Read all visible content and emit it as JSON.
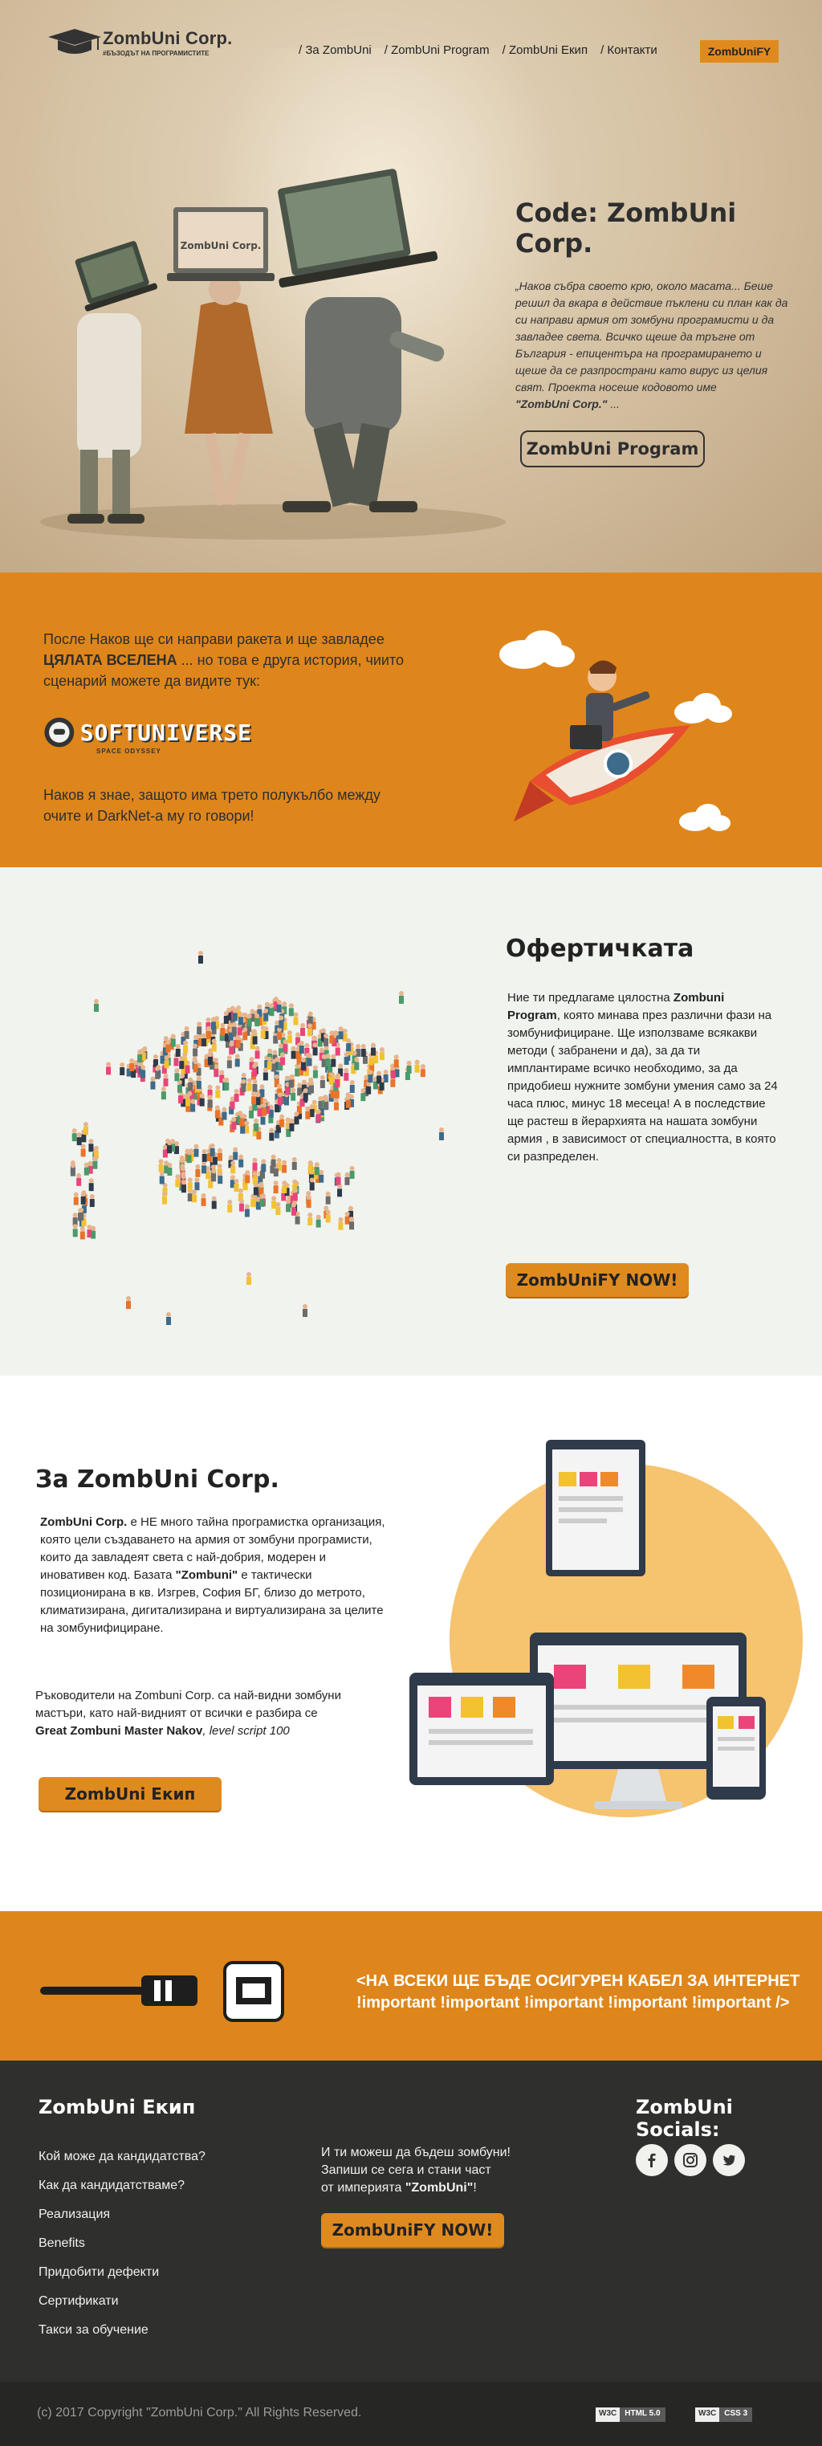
{
  "brand": {
    "name": "ZombUni Corp.",
    "tagline": "#БЪЗОДЪТ НА ПРОГРАМИСТИТЕ"
  },
  "nav": {
    "items": [
      "/ За ZombUni",
      "/ ZombUni Program",
      "/ ZombUni Екип",
      "/ Контакти"
    ],
    "cta": "ZombUniFY"
  },
  "hero": {
    "title": "Code: ZombUni Corp.",
    "text_main": "„Наков събра своето крю, около масата... Беше решил да вкара в действие пъклени си план как да си направи армия от зомбуни програмисти и да завладее света. Всичко щеше да тръгне от България - епицентъра на програмирането и щеше да се разпространи като вирус из целия свят. Проекта носеше кодовото име",
    "text_bold": "\"ZombUni Corp.\"",
    "text_end": " ...",
    "button": "ZombUni Program",
    "laptop_label": "ZombUni Corp."
  },
  "galaxy": {
    "p1_start": "После Наков ще си направи ракета и ще завладее",
    "p1_bold": "ЦЯЛАТА ВСЕЛЕНА",
    "p1_end": "... но това е друга история, чиито сценарий можете да видите тук:",
    "logo_text": "SOFTUNIVERSE",
    "logo_sub": "SPACE ODYSSEY",
    "p2": "Наков я знае, защото има трето полукълбо между очите и DarkNet-а му го говори!"
  },
  "offer": {
    "title": "Офертичката",
    "text_start": "Ние ти предлагаме цялостна",
    "text_bold": "Zombuni Program",
    "text_end": ", която минава през различни фази на зомбунифициране. Ще използваме всякакви методи ( забранени и да), за да ти имплантираме всичко необходимо, за да придобиеш нужните зомбуни умения само за 24 часа плюс, минус 18 месеца! А в последствие ще растеш в йерархията на нашата зомбуни армия , в зависимост от специалността, в която си разпределен.",
    "button": "ZombUniFY NOW!"
  },
  "about": {
    "title": "За ZombUni Corp.",
    "p1_bold": "ZombUni Corp.",
    "p1_a": " е НЕ много тайна програмистка организация, която цели създаването на армия от зомбуни програмисти, които да завладеят света с най-добрия, модерен и иновативен код. Базата ",
    "p1_bold2": "\"Zombuni\"",
    "p1_b": " е тактически позиционирана в кв. Изгрев, София БГ, близо до метрото, климатизирана, дигитализирана и виртуализирана за целите на зомбунифициране.",
    "p2_a": "Ръководители на Zombuni Corp. са най-видни зомбуни мастъри, като най-видният от всички е разбира се",
    "p2_bold": "Great Zombuni Master Nakov",
    "p2_italic": ", level script 100",
    "button": "ZombUni Екип"
  },
  "cable": {
    "line1": "<НА ВСЕКИ ЩЕ БЪДЕ ОСИГУРЕН КАБЕЛ ЗА ИНТЕРНЕТ",
    "line2": "!important !important !important !important !important />"
  },
  "footer": {
    "team_title": "ZombUni Екип",
    "links": [
      "Кой може да кандидатства?",
      "Как да кандидатстваме?",
      "Реализация",
      "Benefits",
      "Придобити дефекти",
      "Сертификати",
      "Такси за обучение"
    ],
    "mid_line1": "И ти можеш да бъдеш зомбуни!",
    "mid_line2": "Запиши се сега и стани част",
    "mid_line3_a": "от империята ",
    "mid_line3_bold": "\"ZombUni\"",
    "mid_line3_b": "!",
    "button": "ZombUniFY NOW!",
    "socials_title": "ZombUni Socials:",
    "socials": [
      "facebook-icon",
      "instagram-icon",
      "twitter-icon"
    ],
    "copyright": "(c) 2017 Copyright \"ZombUni Corp.\" All Rights Reserved.",
    "badge_html_a": "W3C",
    "badge_html_b": "HTML 5.0",
    "badge_css_a": "W3C",
    "badge_css_b": "CSS 3"
  },
  "colors": {
    "accent": "#de861c",
    "footer": "#2f302d",
    "offer_bg": "#f1f3ee"
  }
}
